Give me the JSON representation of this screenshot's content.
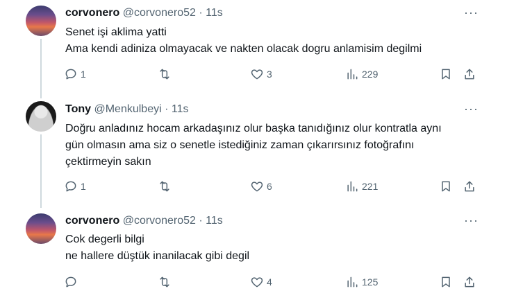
{
  "tweets": [
    {
      "name": "corvonero",
      "handle": "@corvonero52",
      "dot": "·",
      "time": "11s",
      "lines": [
        "Senet işi aklima yatti",
        "Ama kendi adiniza olmayacak ve nakten olacak dogru anlamisim degilmi"
      ],
      "replies": "1",
      "retweets": "",
      "likes": "3",
      "views": "229"
    },
    {
      "name": "Tony",
      "handle": "@Menkulbeyi",
      "dot": "·",
      "time": "11s",
      "lines": [
        "Doğru anladınız hocam arkadaşınız olur başka tanıdığınız olur kontratla aynı",
        "gün olmasın ama siz o senetle istediğiniz zaman çıkarırsınız fotoğrafını",
        "çektirmeyin sakın"
      ],
      "replies": "1",
      "retweets": "",
      "likes": "6",
      "views": "221"
    },
    {
      "name": "corvonero",
      "handle": "@corvonero52",
      "dot": "·",
      "time": "11s",
      "lines": [
        "Cok degerli bilgi",
        "ne hallere düştük inanilacak gibi degil"
      ],
      "replies": "",
      "retweets": "",
      "likes": "4",
      "views": "125"
    }
  ],
  "icons": {
    "avatar1": "sunset-avatar",
    "avatar2": "person-avatar",
    "more": "more-dots-icon",
    "reply": "reply-icon",
    "retweet": "retweet-icon",
    "like": "heart-icon",
    "views": "views-icon",
    "bookmark": "bookmark-icon",
    "share": "share-icon"
  },
  "more_label": "···",
  "colors": {
    "text": "#0f1419",
    "muted": "#536471",
    "line": "#cfd9de",
    "divider": "#eff3f4"
  }
}
